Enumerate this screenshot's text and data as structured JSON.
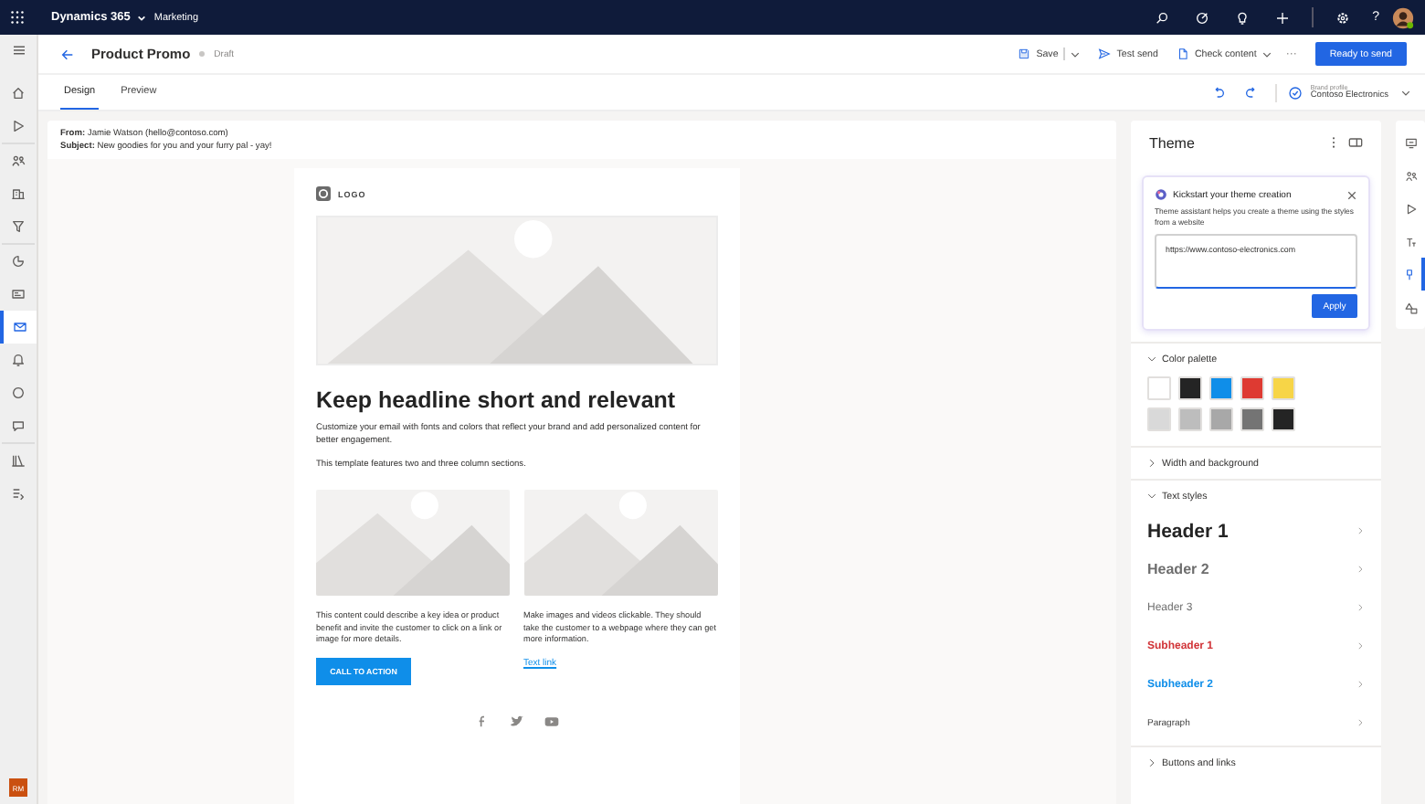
{
  "topbar": {
    "app": "Dynamics 365",
    "area": "Marketing",
    "help": "?"
  },
  "left_rail": [
    {
      "kind": "home",
      "selected": false
    },
    {
      "kind": "play",
      "selected": false
    },
    {
      "kind": "people",
      "selected": false
    },
    {
      "kind": "building",
      "selected": false
    },
    {
      "kind": "funnel",
      "selected": false
    },
    {
      "kind": "pie",
      "selected": false
    },
    {
      "kind": "card",
      "selected": false
    },
    {
      "kind": "mail",
      "selected": true
    },
    {
      "kind": "bell",
      "selected": false
    },
    {
      "kind": "circle",
      "selected": false
    },
    {
      "kind": "chat",
      "selected": false
    },
    {
      "kind": "library",
      "selected": false
    },
    {
      "kind": "list",
      "selected": false
    }
  ],
  "user_initials": "RM",
  "header": {
    "title": "Product Promo",
    "status": "Draft",
    "commands": [
      "Save",
      "Test send",
      "Check content"
    ],
    "more": "···",
    "primary": "Ready to send"
  },
  "tabs": [
    {
      "label": "Design",
      "selected": true
    },
    {
      "label": "Preview",
      "selected": false
    }
  ],
  "brand_profile": {
    "label": "Brand profile",
    "value": "Contoso Electronics"
  },
  "email": {
    "from": "**From:** Jamie Watson (hello@contoso.com)",
    "subject": "**Subject:** New goodies for you and your furry pal - yay!",
    "logo": "LOGO",
    "headline": "Keep headline short and relevant",
    "paragraphs": [
      "Customize your email with fonts and colors that reflect your brand and add personalized content for better engagement.",
      "This template features two and three column sections."
    ],
    "columns": [
      {
        "text": "This content could describe a key idea or product benefit and invite the customer to click on a link or image for more details.",
        "kind": "button",
        "action": "CALL TO ACTION"
      },
      {
        "text": "Make images and videos clickable. They should take the customer to a webpage where they can get more information.",
        "kind": "link",
        "action": "Text link"
      }
    ]
  },
  "theme": {
    "title": "Theme",
    "assistant": {
      "title": "Kickstart your theme creation",
      "description": "Theme assistant helps you create a theme using the styles from a website",
      "value": "https://www.contoso-electronics.com",
      "button": "Apply"
    },
    "sections": [
      {
        "title": "Color palette",
        "expanded": true,
        "swatches": [
          {
            "color": "#ffffff"
          },
          {
            "color": "#242424"
          },
          {
            "color": "#0f8ee9"
          },
          {
            "color": "#de3a32"
          },
          {
            "color": "#f7d547"
          },
          {
            "color": "#d9d9d9"
          },
          {
            "color": "#bdbdbd"
          },
          {
            "color": "#a8a8a8"
          },
          {
            "color": "#747474"
          },
          {
            "color": "#242424"
          }
        ]
      },
      {
        "title": "Width and background",
        "expanded": false
      },
      {
        "title": "Text styles",
        "expanded": true,
        "styles": [
          {
            "kind": "header1",
            "label": "Header 1"
          },
          {
            "kind": "header2",
            "label": "Header 2"
          },
          {
            "kind": "header3",
            "label": "Header 3"
          },
          {
            "kind": "subheader1",
            "label": "Subheader 1"
          },
          {
            "kind": "subheader2",
            "label": "Subheader 2"
          },
          {
            "kind": "paragraph",
            "label": "Paragraph"
          }
        ]
      },
      {
        "title": "Buttons and links",
        "expanded": false
      }
    ]
  },
  "right_rail": [
    {
      "kind": "screen",
      "selected": false
    },
    {
      "kind": "people",
      "selected": false
    },
    {
      "kind": "play",
      "selected": false
    },
    {
      "kind": "text",
      "selected": false
    },
    {
      "kind": "brush",
      "selected": true
    },
    {
      "kind": "shapes",
      "selected": false
    }
  ]
}
